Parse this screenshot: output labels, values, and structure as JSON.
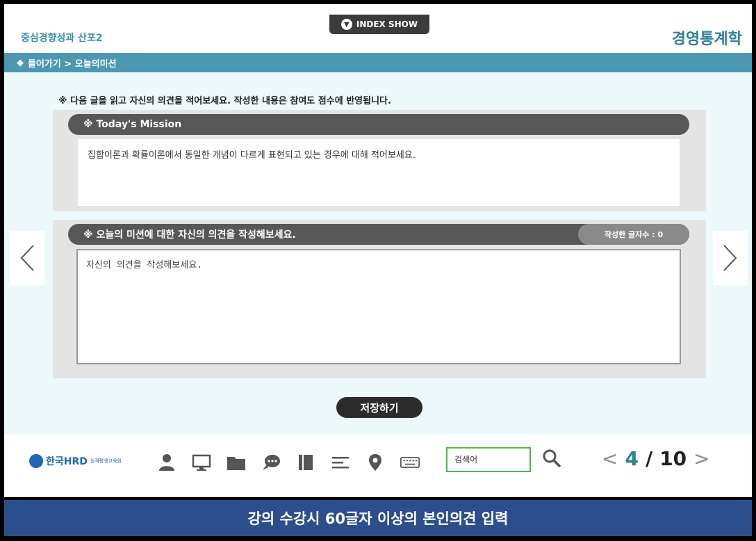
{
  "header": {
    "subtitle": "중심경향성과 산포2",
    "course_title": "경영통계학",
    "index_button_label": "INDEX SHOW"
  },
  "breadcrumb": {
    "marker": "◆",
    "text": "들어가기 > 오늘의미션"
  },
  "content": {
    "instruction": "※ 다음 글을 읽고 자신의 의견을 적어보세요. 작성한 내용은 참여도 점수에 반영됩니다.",
    "mission": {
      "title": "※ Today's Mission",
      "text": "집합이론과 확률이론에서 동일한 개념이 다르게 표현되고 있는 경우에 대해 적어보세요."
    },
    "opinion": {
      "title": "※ 오늘의 미션에 대한 자신의 의견을 작성해보세요.",
      "count_label": "작성한 글자수 : 0",
      "placeholder": "자신의 의견을 작성해보세요."
    },
    "save_label": "저장하기"
  },
  "toolbar": {
    "logo_text": "한국HRD",
    "logo_small": "원격평생교육원",
    "icons": [
      "person-icon",
      "monitor-icon",
      "folder-icon",
      "chat-icon",
      "book-icon",
      "list-icon",
      "location-pin-icon",
      "keyboard-icon"
    ],
    "search_placeholder": "검색어",
    "page_current": "4",
    "page_separator": "/",
    "page_total": "10"
  },
  "caption": "강의 수강시 60글자 이상의 본인의견 입력",
  "colors": {
    "accent": "#4b98b0",
    "title": "#2f7f98",
    "caption_bg": "#2d4e8c",
    "search_border": "#4cb84c"
  }
}
